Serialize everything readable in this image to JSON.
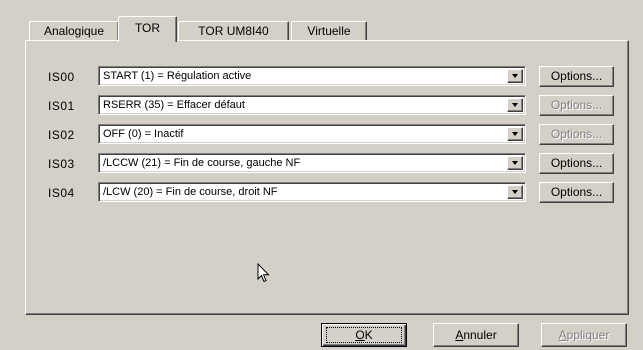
{
  "tabs": [
    {
      "label": "Analogique",
      "active": false
    },
    {
      "label": "TOR",
      "active": true
    },
    {
      "label": "TOR UM8I40",
      "active": false
    },
    {
      "label": "Virtuelle",
      "active": false
    }
  ],
  "rows": [
    {
      "label": "IS00",
      "value": "START (1) = Régulation active",
      "options_label": "Options...",
      "options_enabled": true
    },
    {
      "label": "IS01",
      "value": "RSERR (35) = Effacer défaut",
      "options_label": "Options...",
      "options_enabled": false
    },
    {
      "label": "IS02",
      "value": "OFF (0) = Inactif",
      "options_label": "Options...",
      "options_enabled": false
    },
    {
      "label": "IS03",
      "value": "/LCCW (21) = Fin de course, gauche NF",
      "options_label": "Options...",
      "options_enabled": true
    },
    {
      "label": "IS04",
      "value": "/LCW (20) = Fin de course, droit NF",
      "options_label": "Options...",
      "options_enabled": true
    }
  ],
  "buttons": {
    "ok": {
      "first": "O",
      "rest": "K"
    },
    "cancel": {
      "first": "A",
      "rest": "nnuler"
    },
    "apply": {
      "first": "A",
      "rest": "ppliquer",
      "enabled": false
    }
  },
  "icons": {
    "combo_arrow": "chevron-down-icon",
    "cursor": "mouse-pointer-icon"
  },
  "colors": {
    "face": "#d4d0c8",
    "disabled_text": "#808080",
    "field_bg": "#ffffff"
  }
}
